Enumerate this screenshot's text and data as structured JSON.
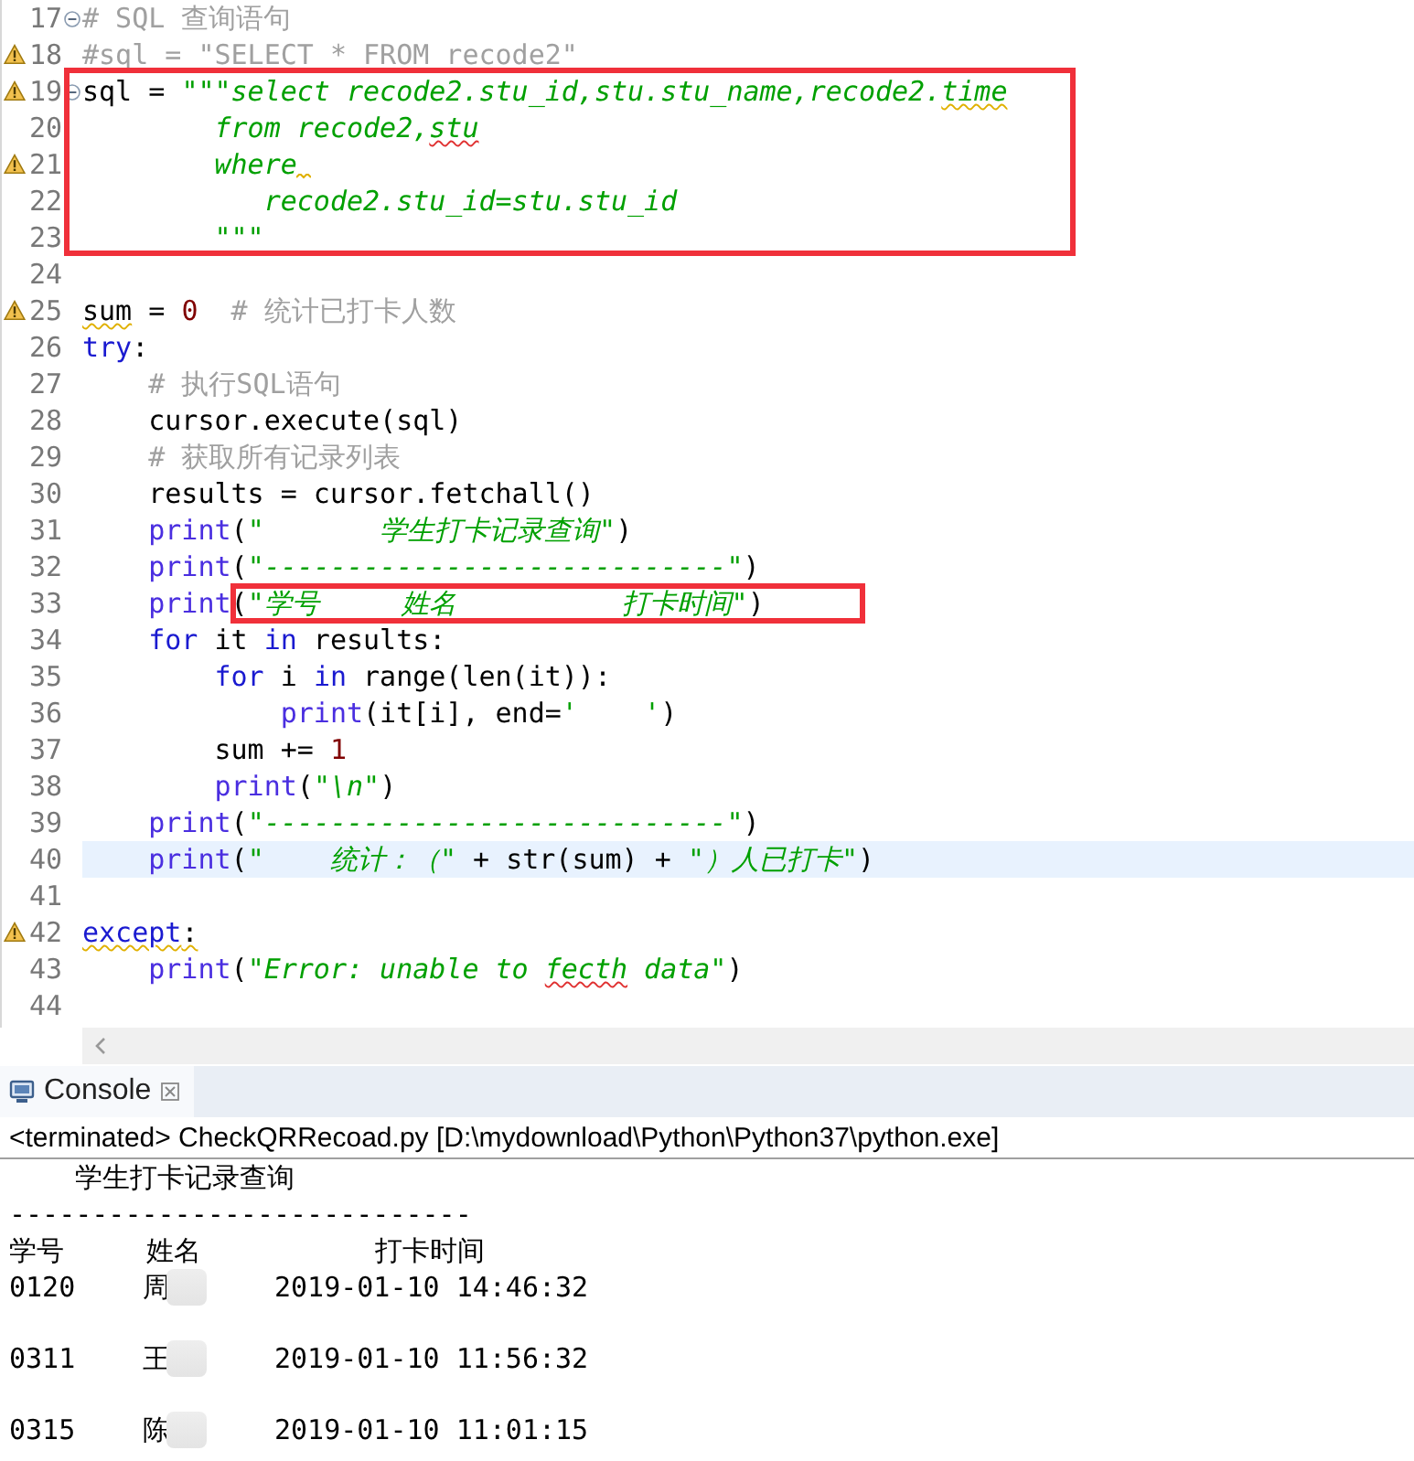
{
  "editor": {
    "lines": [
      {
        "kind": "line",
        "number": "17",
        "fold": true,
        "tokens": [
          {
            "text": "# SQL 查询语句",
            "kind": "comment"
          }
        ]
      },
      {
        "kind": "line",
        "number": "18",
        "warning": true,
        "tokens": [
          {
            "text": "#sql = \"SELECT * FROM recode2\"",
            "kind": "comment"
          }
        ]
      },
      {
        "kind": "group",
        "boxed": true,
        "lines": [
          {
            "kind": "line",
            "number": "19",
            "warning": true,
            "fold": true,
            "tokens": [
              {
                "text": "sql = ",
                "kind": "plain"
              },
              {
                "text": "\"\"\"select recode2.stu_id,stu.stu_name,recode2.",
                "kind": "string"
              },
              {
                "text": "time",
                "kind": "string",
                "warning_underline": true
              }
            ]
          },
          {
            "kind": "line",
            "number": "20",
            "tokens": [
              {
                "text": "        from recode2,",
                "kind": "string"
              },
              {
                "text": "stu",
                "kind": "string",
                "error_underline": true
              }
            ]
          },
          {
            "kind": "line",
            "number": "21",
            "warning": true,
            "trailing_warning": true,
            "tokens": [
              {
                "text": "        where",
                "kind": "string"
              }
            ]
          },
          {
            "kind": "line",
            "number": "22",
            "tokens": [
              {
                "text": "           recode2.stu_id=stu.stu_id",
                "kind": "string"
              }
            ]
          },
          {
            "kind": "line",
            "number": "23",
            "tokens": [
              {
                "text": "        \"\"\"",
                "kind": "string"
              }
            ]
          }
        ]
      },
      {
        "kind": "line",
        "number": "24"
      },
      {
        "kind": "line",
        "number": "25",
        "warning": true,
        "tokens": [
          {
            "text": "sum",
            "kind": "plain",
            "warning_underline": true
          },
          {
            "text": " = ",
            "kind": "plain"
          },
          {
            "text": "0",
            "kind": "number"
          },
          {
            "text": "  # 统计已打卡人数",
            "kind": "comment"
          }
        ]
      },
      {
        "kind": "line",
        "number": "26",
        "tokens": [
          {
            "text": "try",
            "kind": "keyword"
          },
          {
            "text": ":",
            "kind": "plain"
          }
        ]
      },
      {
        "kind": "line",
        "number": "27",
        "tokens": [
          {
            "text": "    # 执行SQL语句",
            "kind": "comment"
          }
        ]
      },
      {
        "kind": "line",
        "number": "28",
        "tokens": [
          {
            "text": "    cursor.execute(sql)",
            "kind": "plain"
          }
        ]
      },
      {
        "kind": "line",
        "number": "29",
        "tokens": [
          {
            "text": "    # 获取所有记录列表",
            "kind": "comment"
          }
        ]
      },
      {
        "kind": "line",
        "number": "30",
        "tokens": [
          {
            "text": "    results = cursor.fetchall()",
            "kind": "plain"
          }
        ]
      },
      {
        "kind": "line",
        "number": "31",
        "tokens": [
          {
            "text": "    print",
            "kind": "builtin"
          },
          {
            "text": "(",
            "kind": "plain"
          },
          {
            "text": "\"       学生打卡记录查询\"",
            "kind": "string"
          },
          {
            "text": ")",
            "kind": "plain"
          }
        ]
      },
      {
        "kind": "line",
        "number": "32",
        "tokens": [
          {
            "text": "    print",
            "kind": "builtin"
          },
          {
            "text": "(",
            "kind": "plain"
          },
          {
            "text": "\"----------------------------\"",
            "kind": "string"
          },
          {
            "text": ")",
            "kind": "plain"
          }
        ]
      },
      {
        "kind": "line",
        "number": "33",
        "tokens": [
          {
            "text": "    print",
            "kind": "builtin"
          },
          {
            "kind": "group",
            "boxed": true,
            "tokens": [
              {
                "text": "(",
                "kind": "plain"
              },
              {
                "text": "\"学号     姓名          打卡时间\"",
                "kind": "string"
              },
              {
                "text": ")",
                "kind": "plain"
              }
            ]
          }
        ]
      },
      {
        "kind": "line",
        "number": "34",
        "tokens": [
          {
            "text": "    for",
            "kind": "keyword"
          },
          {
            "text": " it ",
            "kind": "plain"
          },
          {
            "text": "in",
            "kind": "keyword"
          },
          {
            "text": " results:",
            "kind": "plain"
          }
        ]
      },
      {
        "kind": "line",
        "number": "35",
        "tokens": [
          {
            "text": "        for",
            "kind": "keyword"
          },
          {
            "text": " i ",
            "kind": "plain"
          },
          {
            "text": "in",
            "kind": "keyword"
          },
          {
            "text": " range(len(it)):",
            "kind": "plain"
          }
        ]
      },
      {
        "kind": "line",
        "number": "36",
        "tokens": [
          {
            "text": "            print",
            "kind": "builtin"
          },
          {
            "text": "(it[i], end=",
            "kind": "plain"
          },
          {
            "text": "'    '",
            "kind": "string"
          },
          {
            "text": ")",
            "kind": "plain"
          }
        ]
      },
      {
        "kind": "line",
        "number": "37",
        "tokens": [
          {
            "text": "        sum += ",
            "kind": "plain"
          },
          {
            "text": "1",
            "kind": "number"
          }
        ]
      },
      {
        "kind": "line",
        "number": "38",
        "tokens": [
          {
            "text": "        print",
            "kind": "builtin"
          },
          {
            "text": "(",
            "kind": "plain"
          },
          {
            "text": "\"\\n\"",
            "kind": "string"
          },
          {
            "text": ")",
            "kind": "plain"
          }
        ]
      },
      {
        "kind": "line",
        "number": "39",
        "tokens": [
          {
            "text": "    print",
            "kind": "builtin"
          },
          {
            "text": "(",
            "kind": "plain"
          },
          {
            "text": "\"----------------------------\"",
            "kind": "string"
          },
          {
            "text": ")",
            "kind": "plain"
          }
        ]
      },
      {
        "kind": "line",
        "number": "40",
        "current": true,
        "tokens": [
          {
            "text": "    print",
            "kind": "builtin"
          },
          {
            "text": "(",
            "kind": "plain"
          },
          {
            "text": "\"    统计：（\"",
            "kind": "string"
          },
          {
            "text": " + str(sum) + ",
            "kind": "plain"
          },
          {
            "text": "\"）人已打卡\"",
            "kind": "string"
          },
          {
            "text": ")",
            "kind": "plain"
          }
        ]
      },
      {
        "kind": "line",
        "number": "41"
      },
      {
        "kind": "line",
        "number": "42",
        "warning": true,
        "tokens": [
          {
            "text": "except",
            "kind": "keyword",
            "warning_underline": true
          },
          {
            "text": ":",
            "kind": "plain",
            "warning_underline": true
          }
        ]
      },
      {
        "kind": "line",
        "number": "43",
        "tokens": [
          {
            "text": "    print",
            "kind": "builtin"
          },
          {
            "text": "(",
            "kind": "plain"
          },
          {
            "text": "\"Error: unable to ",
            "kind": "string"
          },
          {
            "text": "fecth",
            "kind": "string",
            "error_underline": true
          },
          {
            "text": " data\"",
            "kind": "string"
          },
          {
            "text": ")",
            "kind": "plain"
          }
        ]
      },
      {
        "kind": "line",
        "number": "44"
      }
    ]
  },
  "console": {
    "tab": {
      "label": "Console",
      "selected": true
    },
    "status": "<terminated> CheckQRRecoad.py [D:\\mydownload\\Python\\Python37\\python.exe]",
    "title": "    学生打卡记录查询",
    "rule": "----------------------------",
    "columns": [
      "学号",
      "姓名",
      "打卡时间"
    ],
    "records": [
      {
        "id": "0120",
        "name": "周",
        "time": "2019-01-10 14:46:32",
        "blank_after": true
      },
      {
        "id": "0311",
        "name": "王",
        "time": "2019-01-10 11:56:32",
        "blank_after": true
      },
      {
        "id": "0315",
        "name": "陈",
        "time": "2019-01-10 11:01:15"
      }
    ]
  }
}
